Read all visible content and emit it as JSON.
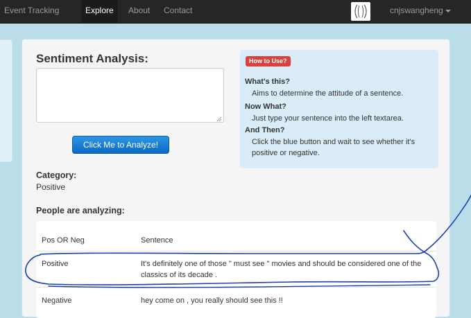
{
  "nav": {
    "items": [
      "Event Tracking",
      "Explore",
      "About",
      "Contact"
    ],
    "active": "Explore",
    "user": "cnjswangheng"
  },
  "analysis": {
    "title": "Sentiment Analysis:",
    "textarea_value": "",
    "button": "Click Me to Analyze!"
  },
  "howto": {
    "badge": "How to Use?",
    "q1": "What's this?",
    "a1": "Aims to determine the attitude of a sentence.",
    "q2": "Now What?",
    "a2": "Just type your sentence into the left textarea.",
    "q3": "And Then?",
    "a3": "Click the blue button and wait to see whether it's positive or negative."
  },
  "category": {
    "label": "Category:",
    "value": "Positive"
  },
  "people": {
    "heading": "People are analyzing:",
    "columns": [
      "Pos OR Neg",
      "Sentence"
    ],
    "rows": [
      {
        "label": "Positive",
        "sentence": "It's definitely one of those \" must see \" movies and should be considered one of the classics of its decade ."
      },
      {
        "label": "Negative",
        "sentence": "hey come on , you really should see this !!"
      }
    ]
  },
  "colors": {
    "navbar": "#262626",
    "page_bg": "#b9dde9",
    "button": "#0a69c4",
    "badge": "#d9413d",
    "howto_bg": "#d9ecf8",
    "annotation_ink": "#1a3fb0"
  },
  "icons": [
    "logo-icon",
    "caret-down-icon",
    "resize-grip-icon"
  ]
}
